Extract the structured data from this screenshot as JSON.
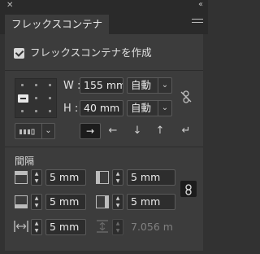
{
  "titlebar": {
    "close_glyph": "✕",
    "collapse_glyph": "‹‹"
  },
  "tab": {
    "label": "フレックスコンテナ"
  },
  "container": {
    "checkbox_label": "フレックスコンテナを作成",
    "checked": true
  },
  "size": {
    "w_label": "W :",
    "w_value": "155 mm",
    "w_mode": "自動",
    "h_label": "H :",
    "h_value": "40 mm",
    "h_mode": "自動",
    "chev": "⌄"
  },
  "direction": {
    "wrap_chev": "⌄",
    "buttons": [
      {
        "name": "row",
        "glyph": "→"
      },
      {
        "name": "row-reverse",
        "glyph": "←"
      },
      {
        "name": "column",
        "glyph": "↓"
      },
      {
        "name": "column-reverse",
        "glyph": "↑"
      }
    ],
    "wrap_glyph": "↵"
  },
  "spacing": {
    "title": "間隔",
    "top": "5 mm",
    "left": "5 mm",
    "bottom": "5 mm",
    "right": "5 mm",
    "gap": "5 mm",
    "gap_alt": "7.056 m"
  },
  "colors": {
    "panel": "#3c3c3c",
    "active_button": "#1c1c1c"
  }
}
